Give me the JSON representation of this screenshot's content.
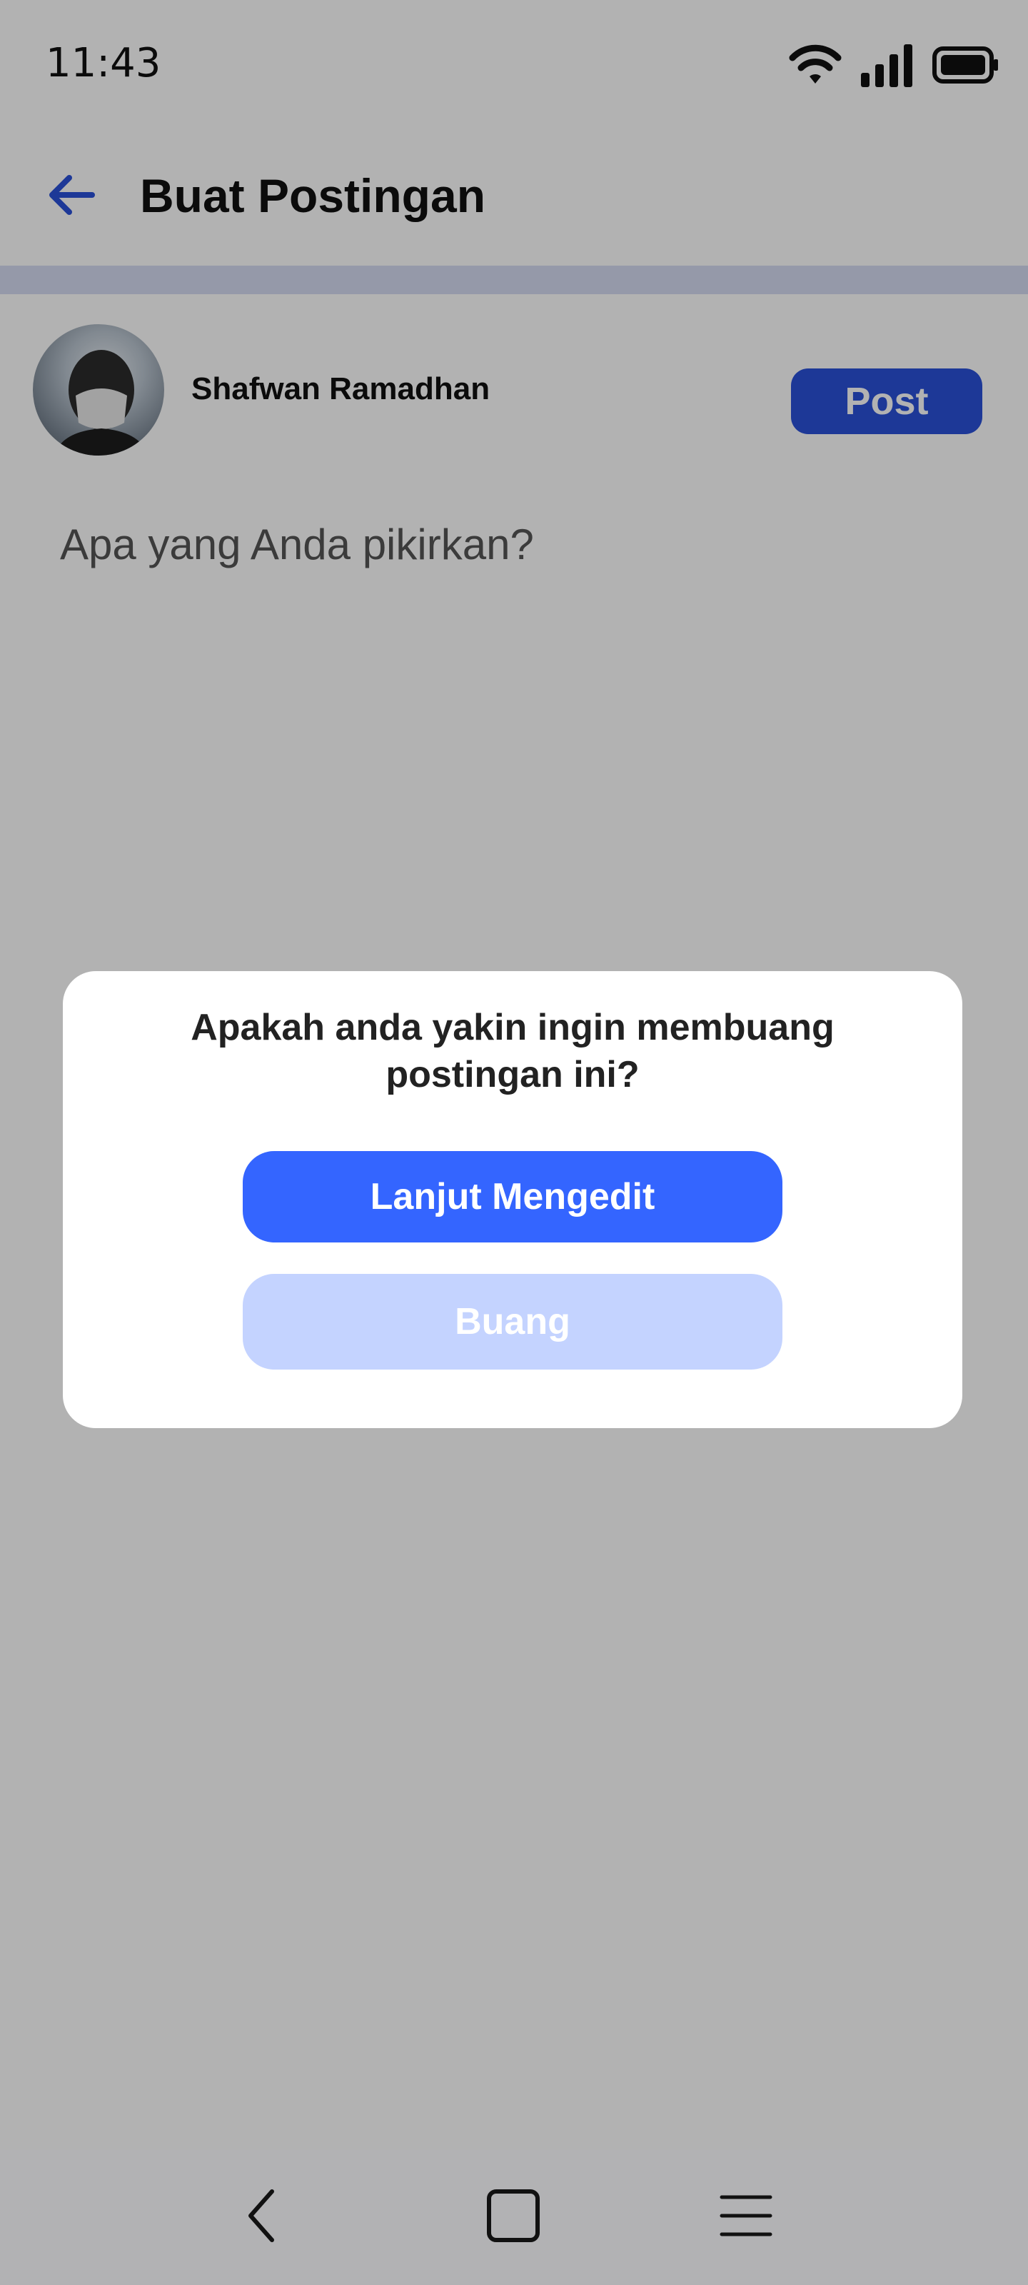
{
  "status_bar": {
    "time": "11:43",
    "icons": [
      "wifi-icon",
      "signal-icon",
      "battery-icon"
    ]
  },
  "header": {
    "back_icon": "arrow-left-icon",
    "title": "Buat Postingan"
  },
  "composer": {
    "user_name": "Shafwan Ramadhan",
    "post_label": "Post",
    "placeholder": "Apa yang Anda pikirkan?"
  },
  "dialog": {
    "title": "Apakah anda yakin ingin membuang postingan ini?",
    "primary_label": "Lanjut Mengedit",
    "secondary_label": "Buang"
  },
  "nav": {
    "icons": [
      "nav-back-icon",
      "nav-home-icon",
      "nav-menu-icon"
    ]
  },
  "colors": {
    "accent": "#3465ff",
    "accent_dark": "#2a51d9",
    "accent_light": "#c4d3ff",
    "overlay": "rgba(0,0,0,0.30)"
  }
}
